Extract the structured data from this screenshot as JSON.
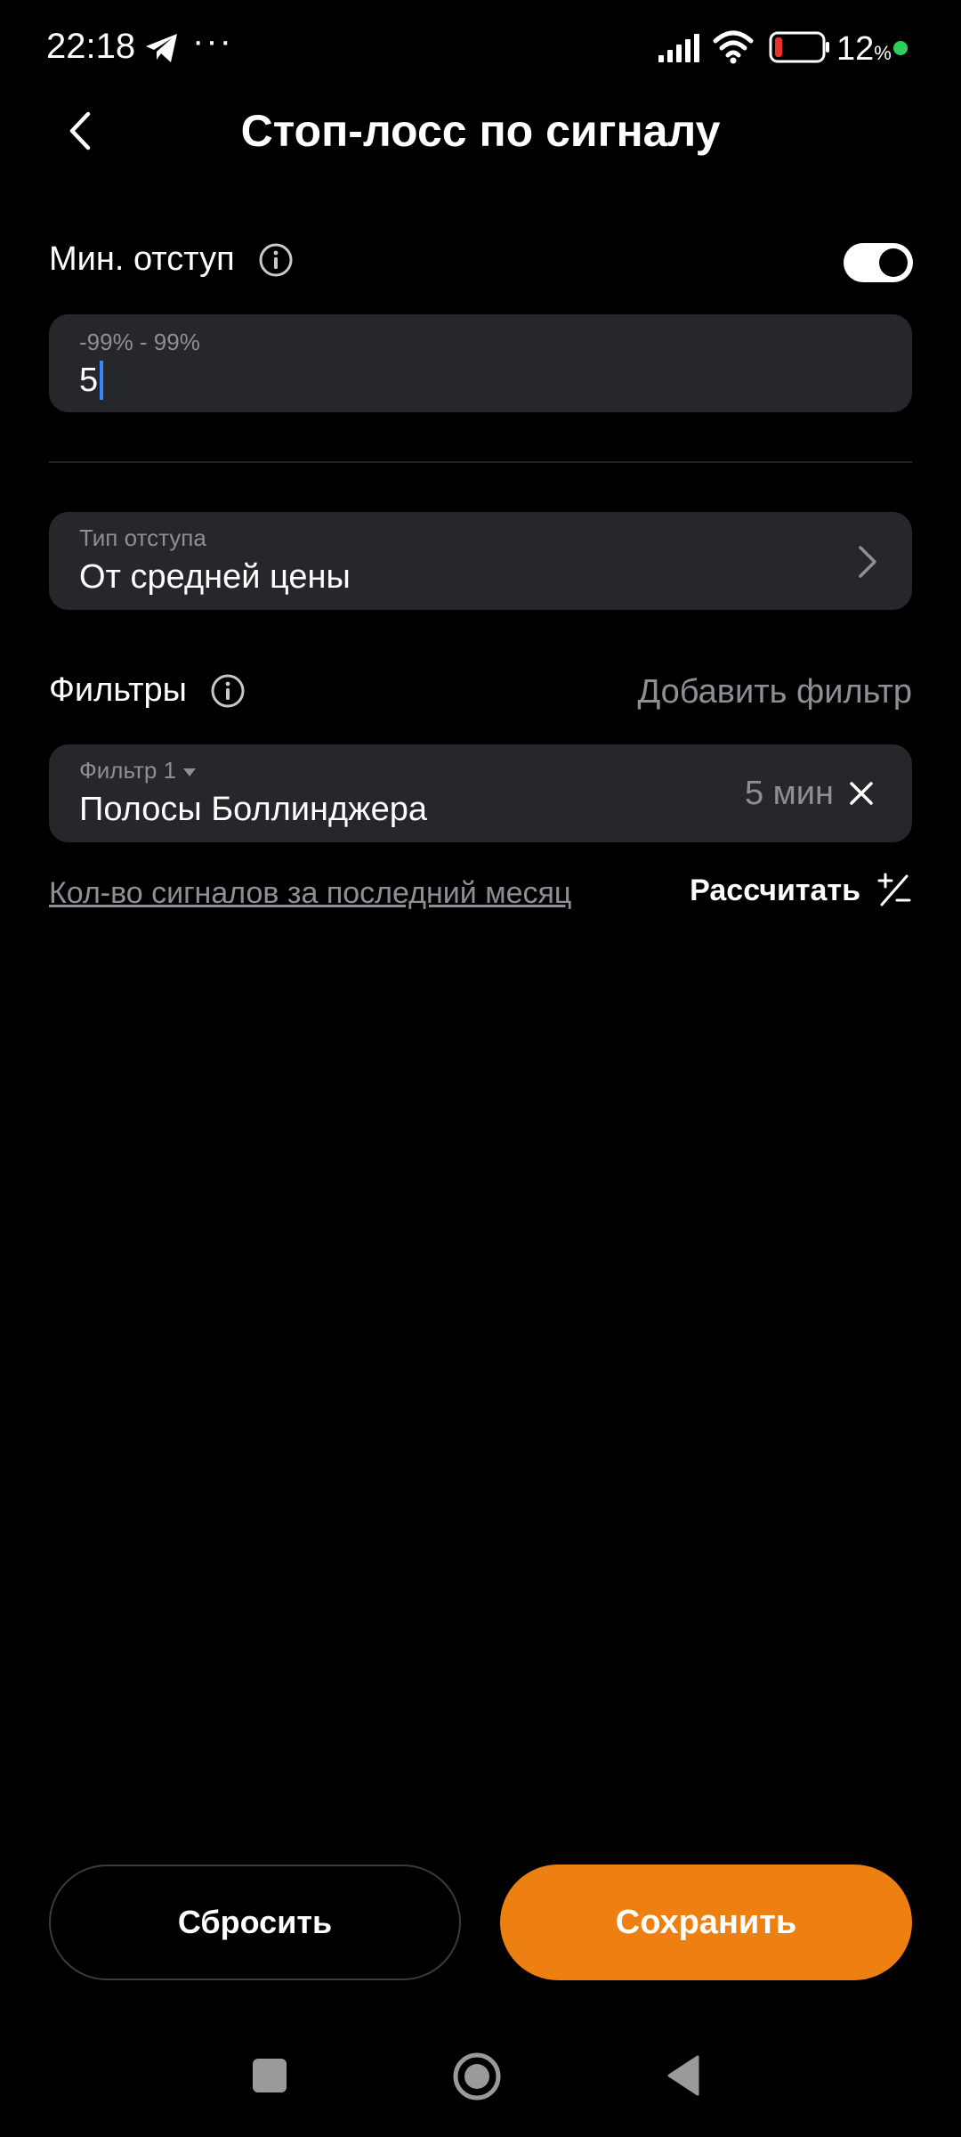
{
  "status_bar": {
    "time": "22:18",
    "more": "···",
    "battery_percent": "12",
    "battery_unit": "%",
    "icons": [
      "telegram-icon",
      "signal-icon",
      "wifi-icon",
      "battery-icon"
    ]
  },
  "header": {
    "title": "Стоп-лосс по сигналу",
    "back_icon": "chevron-left-icon"
  },
  "min_offset": {
    "label": "Мин. отступ",
    "enabled": true,
    "input_hint": "-99% - 99%",
    "input_value": "5"
  },
  "offset_type": {
    "hint": "Тип отступа",
    "value": "От средней цены"
  },
  "filters": {
    "label": "Фильтры",
    "add_label": "Добавить фильтр",
    "items": [
      {
        "name": "Фильтр 1",
        "value": "Полосы Боллинджера",
        "interval": "5 мин"
      }
    ]
  },
  "signals": {
    "link_text": "Кол-во сигналов за последний месяц",
    "calc_label": "Рассчитать"
  },
  "actions": {
    "reset_label": "Сбросить",
    "save_label": "Сохранить"
  },
  "colors": {
    "background": "#000000",
    "field": "#25272b",
    "accent": "#ee8012",
    "muted_text": "#8d8f94",
    "caret": "#3a86ff"
  }
}
